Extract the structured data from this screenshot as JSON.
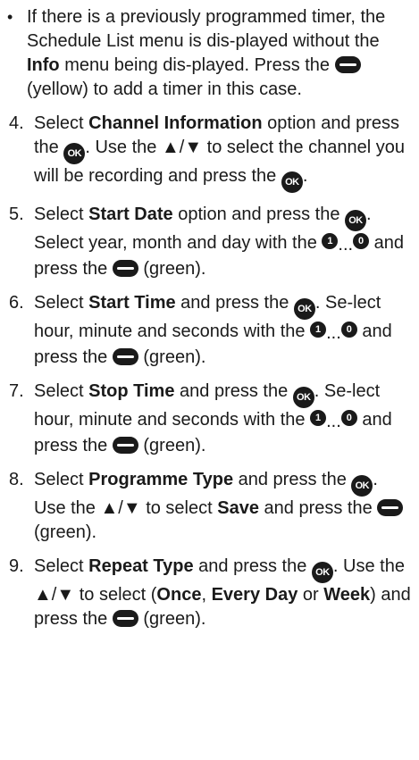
{
  "intro": {
    "bullet": "•",
    "p1": "If there is a previously programmed timer, the Schedule List menu is dis-played without the ",
    "info": "Info",
    "p2": " menu being dis-played. Press the ",
    "p3": " (yellow) to add a timer in this case."
  },
  "icons": {
    "ok": "OK",
    "one": "1",
    "zero": "0",
    "dots": "...",
    "arrows": "▲/▼"
  },
  "steps": [
    {
      "num": "4.",
      "t1": "Select ",
      "b1": "Channel Information",
      "t2": " option and press the ",
      "t3": ". Use the ",
      "t4": " to select the channel you will be recording and press the ",
      "t5": "."
    },
    {
      "num": "5.",
      "t1": "Select ",
      "b1": "Start Date",
      "t2": " option and press the ",
      "t3": ". Select year, month and day with the ",
      "t4": " and press the ",
      "t5": " (green)."
    },
    {
      "num": "6.",
      "t1": "Select ",
      "b1": "Start Time",
      "t2": " and press the ",
      "t3": ". Se-lect hour, minute and seconds with the ",
      "t4": " and press the ",
      "t5": " (green)."
    },
    {
      "num": "7.",
      "t1": "Select ",
      "b1": "Stop Time",
      "t2": " and press the ",
      "t3": ". Se-lect hour, minute and seconds with the ",
      "t4": " and press the ",
      "t5": " (green)."
    },
    {
      "num": "8.",
      "t1": "Select ",
      "b1": "Programme Type",
      "t2": " and press the ",
      "t3": ". Use the ",
      "t4": " to select ",
      "b2": "Save",
      "t5": " and press the ",
      "t6": " (green)."
    },
    {
      "num": "9.",
      "t1": "Select ",
      "b1": "Repeat Type",
      "t2": " and press the ",
      "t3": ". Use the ",
      "t4": " to select (",
      "b2": "Once",
      "t5": ", ",
      "b3": "Every Day",
      "t6": " or ",
      "b4": "Week",
      "t7": ") and press the ",
      "t8": " (green)."
    }
  ]
}
